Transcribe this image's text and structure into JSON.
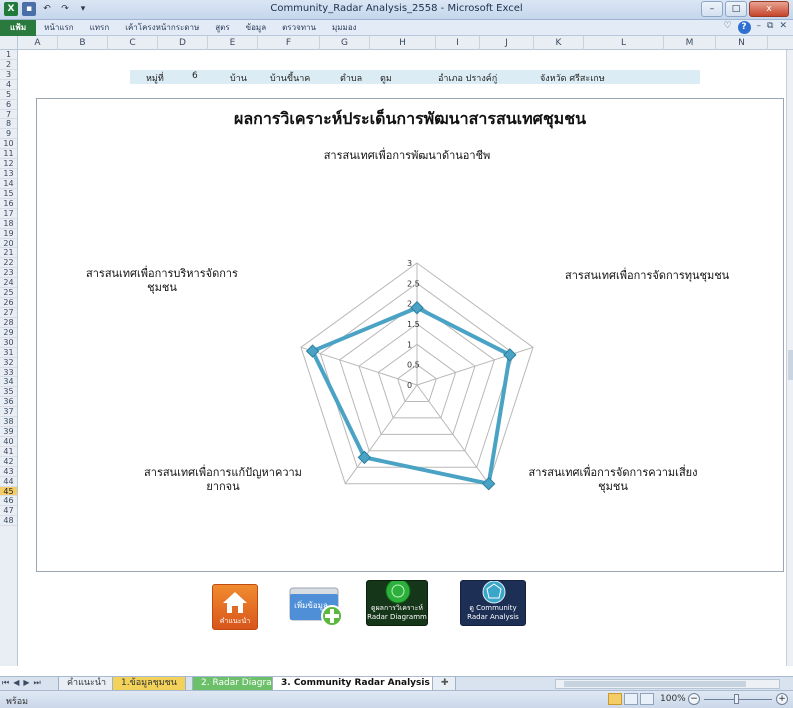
{
  "window": {
    "title": "Community_Radar Analysis_2558 - Microsoft Excel",
    "close_glyph": "x",
    "min_glyph": "–",
    "max_glyph": "□"
  },
  "ribbon": {
    "tabs": [
      "แฟ้ม",
      "หน้าแรก",
      "แทรก",
      "เค้าโครงหน้ากระดาษ",
      "สูตร",
      "ข้อมูล",
      "ตรวจทาน",
      "มุมมอง"
    ]
  },
  "columns": [
    "A",
    "B",
    "C",
    "D",
    "E",
    "F",
    "G",
    "H",
    "I",
    "J",
    "K",
    "L",
    "M",
    "N"
  ],
  "rows": [
    "1",
    "2",
    "3",
    "4",
    "5",
    "6",
    "7",
    "8",
    "9",
    "10",
    "11",
    "12",
    "13",
    "14",
    "15",
    "16",
    "17",
    "18",
    "19",
    "20",
    "21",
    "22",
    "23",
    "24",
    "25",
    "26",
    "27",
    "28",
    "29",
    "30",
    "31",
    "32",
    "33",
    "34",
    "35",
    "36",
    "37",
    "38",
    "39",
    "40",
    "41",
    "42",
    "43",
    "44",
    "45",
    "46",
    "47",
    "48"
  ],
  "active_row": "45",
  "info": {
    "village_no_label": "หมู่ที่",
    "village_no": "6",
    "village_label": "บ้าน",
    "village": "บ้านขี้นาค",
    "subdistrict_label": "ตำบล",
    "subdistrict": "ตูม",
    "district": "อำเภอ ปรางค์กู่",
    "province": "จังหวัด ศรีสะเกษ"
  },
  "chart_data": {
    "type": "radar",
    "title": "ผลการวิเคราะห์ประเด็นการพัฒนาสารสนเทศชุมชน",
    "categories": [
      "สารสนเทศเพื่อการพัฒนาด้านอาชีพ",
      "สารสนเทศเพื่อการจัดการทุนชุมชน",
      "สารสนเทศเพื่อการจัดการความเสี่ยงชุมชน",
      "สารสนเทศเพื่อการแก้ปัญหาความยากจน",
      "สารสนเทศเพื่อการบริหารจัดการชุมชน"
    ],
    "values": [
      1.9,
      2.4,
      3.0,
      2.2,
      2.7
    ],
    "rmax": 3,
    "ticks": [
      "0",
      "0.5",
      "1",
      "1.5",
      "2",
      "2.5",
      "3"
    ],
    "series_color": "#4aa3c4",
    "grid": true
  },
  "axis_labels": {
    "top": "สารสนเทศเพื่อการพัฒนาด้านอาชีพ",
    "right": "สารสนเทศเพื่อการจัดการทุนชุมชน",
    "bottom_right_1": "สารสนเทศเพื่อการจัดการความเสี่ยง",
    "bottom_right_2": "ชุมชน",
    "bottom_left_1": "สารสนเทศเพื่อการแก้ปัญหาความ",
    "bottom_left_2": "ยากจน",
    "left_1": "สารสนเทศเพื่อการบริหารจัดการ",
    "left_2": "ชุมชน"
  },
  "buttons": {
    "home": "คำแนะนำ",
    "add": "เพิ่มข้อมูล",
    "radar_1": "ดูผลการวิเคราะห์",
    "radar_2": "Radar Diagramm",
    "analysis_1": "ดู Community",
    "analysis_2": "Radar Analysis"
  },
  "sheet_tabs": [
    "คำแนะนำ",
    "1.ข้อมูลชุมชน",
    "2. Radar Diagram",
    "3. Community Radar Analysis"
  ],
  "status": {
    "ready": "พร้อม",
    "zoom": "100%"
  }
}
